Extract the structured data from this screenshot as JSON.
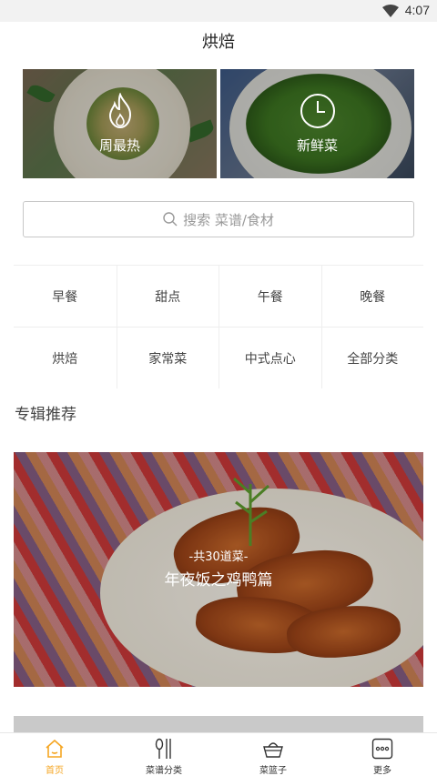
{
  "status": {
    "time": "4:07"
  },
  "header": {
    "title": "烘焙"
  },
  "banners": [
    {
      "label": "周最热",
      "icon": "flame-icon"
    },
    {
      "label": "新鲜菜",
      "icon": "clock-icon"
    }
  ],
  "search": {
    "placeholder": "搜索  菜谱/食材"
  },
  "categories": [
    [
      "早餐",
      "甜点",
      "午餐",
      "晚餐"
    ],
    [
      "烘焙",
      "家常菜",
      "中式点心",
      "全部分类"
    ]
  ],
  "section": {
    "title": "专辑推荐"
  },
  "feature": {
    "count_text": "-共30道菜-",
    "title": "年夜饭之鸡鸭篇"
  },
  "tabs": [
    {
      "label": "首页",
      "icon": "home-icon",
      "active": true
    },
    {
      "label": "菜谱分类",
      "icon": "utensils-icon",
      "active": false
    },
    {
      "label": "菜篮子",
      "icon": "basket-icon",
      "active": false
    },
    {
      "label": "更多",
      "icon": "more-icon",
      "active": false
    }
  ],
  "colors": {
    "accent": "#f5a623",
    "text": "#333333",
    "divider": "#eeeeee"
  }
}
